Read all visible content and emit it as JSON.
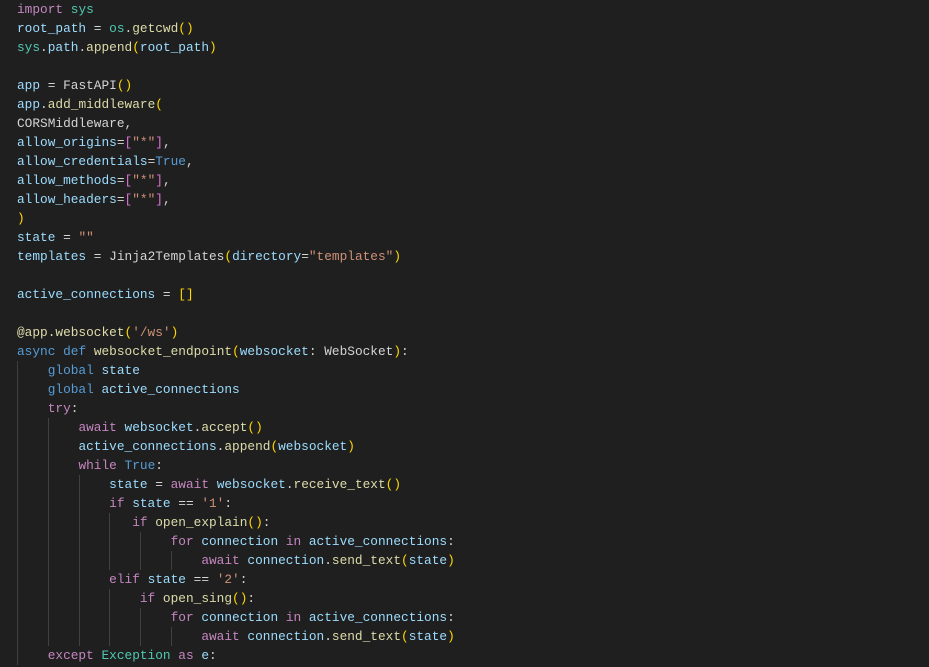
{
  "editor": {
    "language": "python",
    "theme_colors": {
      "background": "#1f1f1f",
      "keyword": "#c586c0",
      "variable": "#9cdcfe",
      "function": "#dcdcaa",
      "module_class": "#4ec9b0",
      "string": "#ce9178",
      "constant": "#569cd6",
      "bracket_level1": "#ffd700",
      "bracket_level2": "#da70d6"
    },
    "lines": [
      {
        "indent": 0,
        "tokens": [
          [
            "import",
            "k"
          ],
          [
            " ",
            "p"
          ],
          [
            "sys",
            "m"
          ]
        ]
      },
      {
        "indent": 0,
        "tokens": [
          [
            "root_path",
            "v"
          ],
          [
            " = ",
            "p"
          ],
          [
            "os",
            "m"
          ],
          [
            ".",
            "p"
          ],
          [
            "getcwd",
            "f"
          ],
          [
            "()",
            "b1"
          ]
        ]
      },
      {
        "indent": 0,
        "tokens": [
          [
            "sys",
            "m"
          ],
          [
            ".",
            "p"
          ],
          [
            "path",
            "v"
          ],
          [
            ".",
            "p"
          ],
          [
            "append",
            "f"
          ],
          [
            "(",
            "b1"
          ],
          [
            "root_path",
            "v"
          ],
          [
            ")",
            "b1"
          ]
        ]
      },
      {
        "indent": 0,
        "tokens": []
      },
      {
        "indent": 0,
        "tokens": [
          [
            "app",
            "v"
          ],
          [
            " = ",
            "p"
          ],
          [
            "FastAPI",
            "p"
          ],
          [
            "()",
            "b1"
          ]
        ]
      },
      {
        "indent": 0,
        "tokens": [
          [
            "app",
            "v"
          ],
          [
            ".",
            "p"
          ],
          [
            "add_middleware",
            "f"
          ],
          [
            "(",
            "b1"
          ]
        ]
      },
      {
        "indent": 0,
        "tokens": [
          [
            "CORSMiddleware",
            "p"
          ],
          [
            ",",
            "p"
          ]
        ]
      },
      {
        "indent": 0,
        "tokens": [
          [
            "allow_origins",
            "v"
          ],
          [
            "=",
            "p"
          ],
          [
            "[",
            "b2"
          ],
          [
            "\"*\"",
            "s"
          ],
          [
            "]",
            "b2"
          ],
          [
            ",",
            "p"
          ]
        ]
      },
      {
        "indent": 0,
        "tokens": [
          [
            "allow_credentials",
            "v"
          ],
          [
            "=",
            "p"
          ],
          [
            "True",
            "c"
          ],
          [
            ",",
            "p"
          ]
        ]
      },
      {
        "indent": 0,
        "tokens": [
          [
            "allow_methods",
            "v"
          ],
          [
            "=",
            "p"
          ],
          [
            "[",
            "b2"
          ],
          [
            "\"*\"",
            "s"
          ],
          [
            "]",
            "b2"
          ],
          [
            ",",
            "p"
          ]
        ]
      },
      {
        "indent": 0,
        "tokens": [
          [
            "allow_headers",
            "v"
          ],
          [
            "=",
            "p"
          ],
          [
            "[",
            "b2"
          ],
          [
            "\"*\"",
            "s"
          ],
          [
            "]",
            "b2"
          ],
          [
            ",",
            "p"
          ]
        ]
      },
      {
        "indent": 0,
        "tokens": [
          [
            ")",
            "b1"
          ]
        ]
      },
      {
        "indent": 0,
        "tokens": [
          [
            "state",
            "v"
          ],
          [
            " = ",
            "p"
          ],
          [
            "\"\"",
            "s"
          ]
        ]
      },
      {
        "indent": 0,
        "tokens": [
          [
            "templates",
            "v"
          ],
          [
            " = ",
            "p"
          ],
          [
            "Jinja2Templates",
            "p"
          ],
          [
            "(",
            "b1"
          ],
          [
            "directory",
            "v"
          ],
          [
            "=",
            "p"
          ],
          [
            "\"templates\"",
            "s"
          ],
          [
            ")",
            "b1"
          ]
        ]
      },
      {
        "indent": 0,
        "tokens": []
      },
      {
        "indent": 0,
        "tokens": [
          [
            "active_connections",
            "v"
          ],
          [
            " = ",
            "p"
          ],
          [
            "[]",
            "b1"
          ]
        ]
      },
      {
        "indent": 0,
        "tokens": []
      },
      {
        "indent": 0,
        "tokens": [
          [
            "@app.websocket",
            "f"
          ],
          [
            "(",
            "b1"
          ],
          [
            "'/ws'",
            "s"
          ],
          [
            ")",
            "b1"
          ]
        ]
      },
      {
        "indent": 0,
        "tokens": [
          [
            "async",
            "c"
          ],
          [
            " ",
            "p"
          ],
          [
            "def",
            "c"
          ],
          [
            " ",
            "p"
          ],
          [
            "websocket_endpoint",
            "f"
          ],
          [
            "(",
            "b1"
          ],
          [
            "websocket",
            "v"
          ],
          [
            ": ",
            "p"
          ],
          [
            "WebSocket",
            "p"
          ],
          [
            ")",
            "b1"
          ],
          [
            ":",
            "p"
          ]
        ]
      },
      {
        "indent": 4,
        "tokens": [
          [
            "global",
            "c"
          ],
          [
            " ",
            "p"
          ],
          [
            "state",
            "v"
          ]
        ]
      },
      {
        "indent": 4,
        "tokens": [
          [
            "global",
            "c"
          ],
          [
            " ",
            "p"
          ],
          [
            "active_connections",
            "v"
          ]
        ]
      },
      {
        "indent": 4,
        "tokens": [
          [
            "try",
            "k"
          ],
          [
            ":",
            "p"
          ]
        ]
      },
      {
        "indent": 8,
        "tokens": [
          [
            "await",
            "k"
          ],
          [
            " ",
            "p"
          ],
          [
            "websocket",
            "v"
          ],
          [
            ".",
            "p"
          ],
          [
            "accept",
            "f"
          ],
          [
            "()",
            "b1"
          ]
        ]
      },
      {
        "indent": 8,
        "tokens": [
          [
            "active_connections",
            "v"
          ],
          [
            ".",
            "p"
          ],
          [
            "append",
            "f"
          ],
          [
            "(",
            "b1"
          ],
          [
            "websocket",
            "v"
          ],
          [
            ")",
            "b1"
          ]
        ]
      },
      {
        "indent": 8,
        "tokens": [
          [
            "while",
            "k"
          ],
          [
            " ",
            "p"
          ],
          [
            "True",
            "c"
          ],
          [
            ":",
            "p"
          ]
        ]
      },
      {
        "indent": 12,
        "tokens": [
          [
            "state",
            "v"
          ],
          [
            " = ",
            "p"
          ],
          [
            "await",
            "k"
          ],
          [
            " ",
            "p"
          ],
          [
            "websocket",
            "v"
          ],
          [
            ".",
            "p"
          ],
          [
            "receive_text",
            "f"
          ],
          [
            "()",
            "b1"
          ]
        ]
      },
      {
        "indent": 12,
        "tokens": [
          [
            "if",
            "k"
          ],
          [
            " ",
            "p"
          ],
          [
            "state",
            "v"
          ],
          [
            " == ",
            "p"
          ],
          [
            "'1'",
            "s"
          ],
          [
            ":",
            "p"
          ]
        ]
      },
      {
        "indent": 15,
        "tokens": [
          [
            "if",
            "k"
          ],
          [
            " ",
            "p"
          ],
          [
            "open_explain",
            "f"
          ],
          [
            "()",
            "b1"
          ],
          [
            ":",
            "p"
          ]
        ]
      },
      {
        "indent": 20,
        "tokens": [
          [
            "for",
            "k"
          ],
          [
            " ",
            "p"
          ],
          [
            "connection",
            "v"
          ],
          [
            " ",
            "p"
          ],
          [
            "in",
            "k"
          ],
          [
            " ",
            "p"
          ],
          [
            "active_connections",
            "v"
          ],
          [
            ":",
            "p"
          ]
        ]
      },
      {
        "indent": 24,
        "tokens": [
          [
            "await",
            "k"
          ],
          [
            " ",
            "p"
          ],
          [
            "connection",
            "v"
          ],
          [
            ".",
            "p"
          ],
          [
            "send_text",
            "f"
          ],
          [
            "(",
            "b1"
          ],
          [
            "state",
            "v"
          ],
          [
            ")",
            "b1"
          ]
        ]
      },
      {
        "indent": 12,
        "tokens": [
          [
            "elif",
            "k"
          ],
          [
            " ",
            "p"
          ],
          [
            "state",
            "v"
          ],
          [
            " == ",
            "p"
          ],
          [
            "'2'",
            "s"
          ],
          [
            ":",
            "p"
          ]
        ]
      },
      {
        "indent": 16,
        "tokens": [
          [
            "if",
            "k"
          ],
          [
            " ",
            "p"
          ],
          [
            "open_sing",
            "f"
          ],
          [
            "()",
            "b1"
          ],
          [
            ":",
            "p"
          ]
        ]
      },
      {
        "indent": 20,
        "tokens": [
          [
            "for",
            "k"
          ],
          [
            " ",
            "p"
          ],
          [
            "connection",
            "v"
          ],
          [
            " ",
            "p"
          ],
          [
            "in",
            "k"
          ],
          [
            " ",
            "p"
          ],
          [
            "active_connections",
            "v"
          ],
          [
            ":",
            "p"
          ]
        ]
      },
      {
        "indent": 24,
        "tokens": [
          [
            "await",
            "k"
          ],
          [
            " ",
            "p"
          ],
          [
            "connection",
            "v"
          ],
          [
            ".",
            "p"
          ],
          [
            "send_text",
            "f"
          ],
          [
            "(",
            "b1"
          ],
          [
            "state",
            "v"
          ],
          [
            ")",
            "b1"
          ]
        ]
      },
      {
        "indent": 4,
        "tokens": [
          [
            "except",
            "k"
          ],
          [
            " ",
            "p"
          ],
          [
            "Exception",
            "m"
          ],
          [
            " ",
            "p"
          ],
          [
            "as",
            "k"
          ],
          [
            " ",
            "p"
          ],
          [
            "e",
            "v"
          ],
          [
            ":",
            "p"
          ]
        ]
      }
    ]
  }
}
